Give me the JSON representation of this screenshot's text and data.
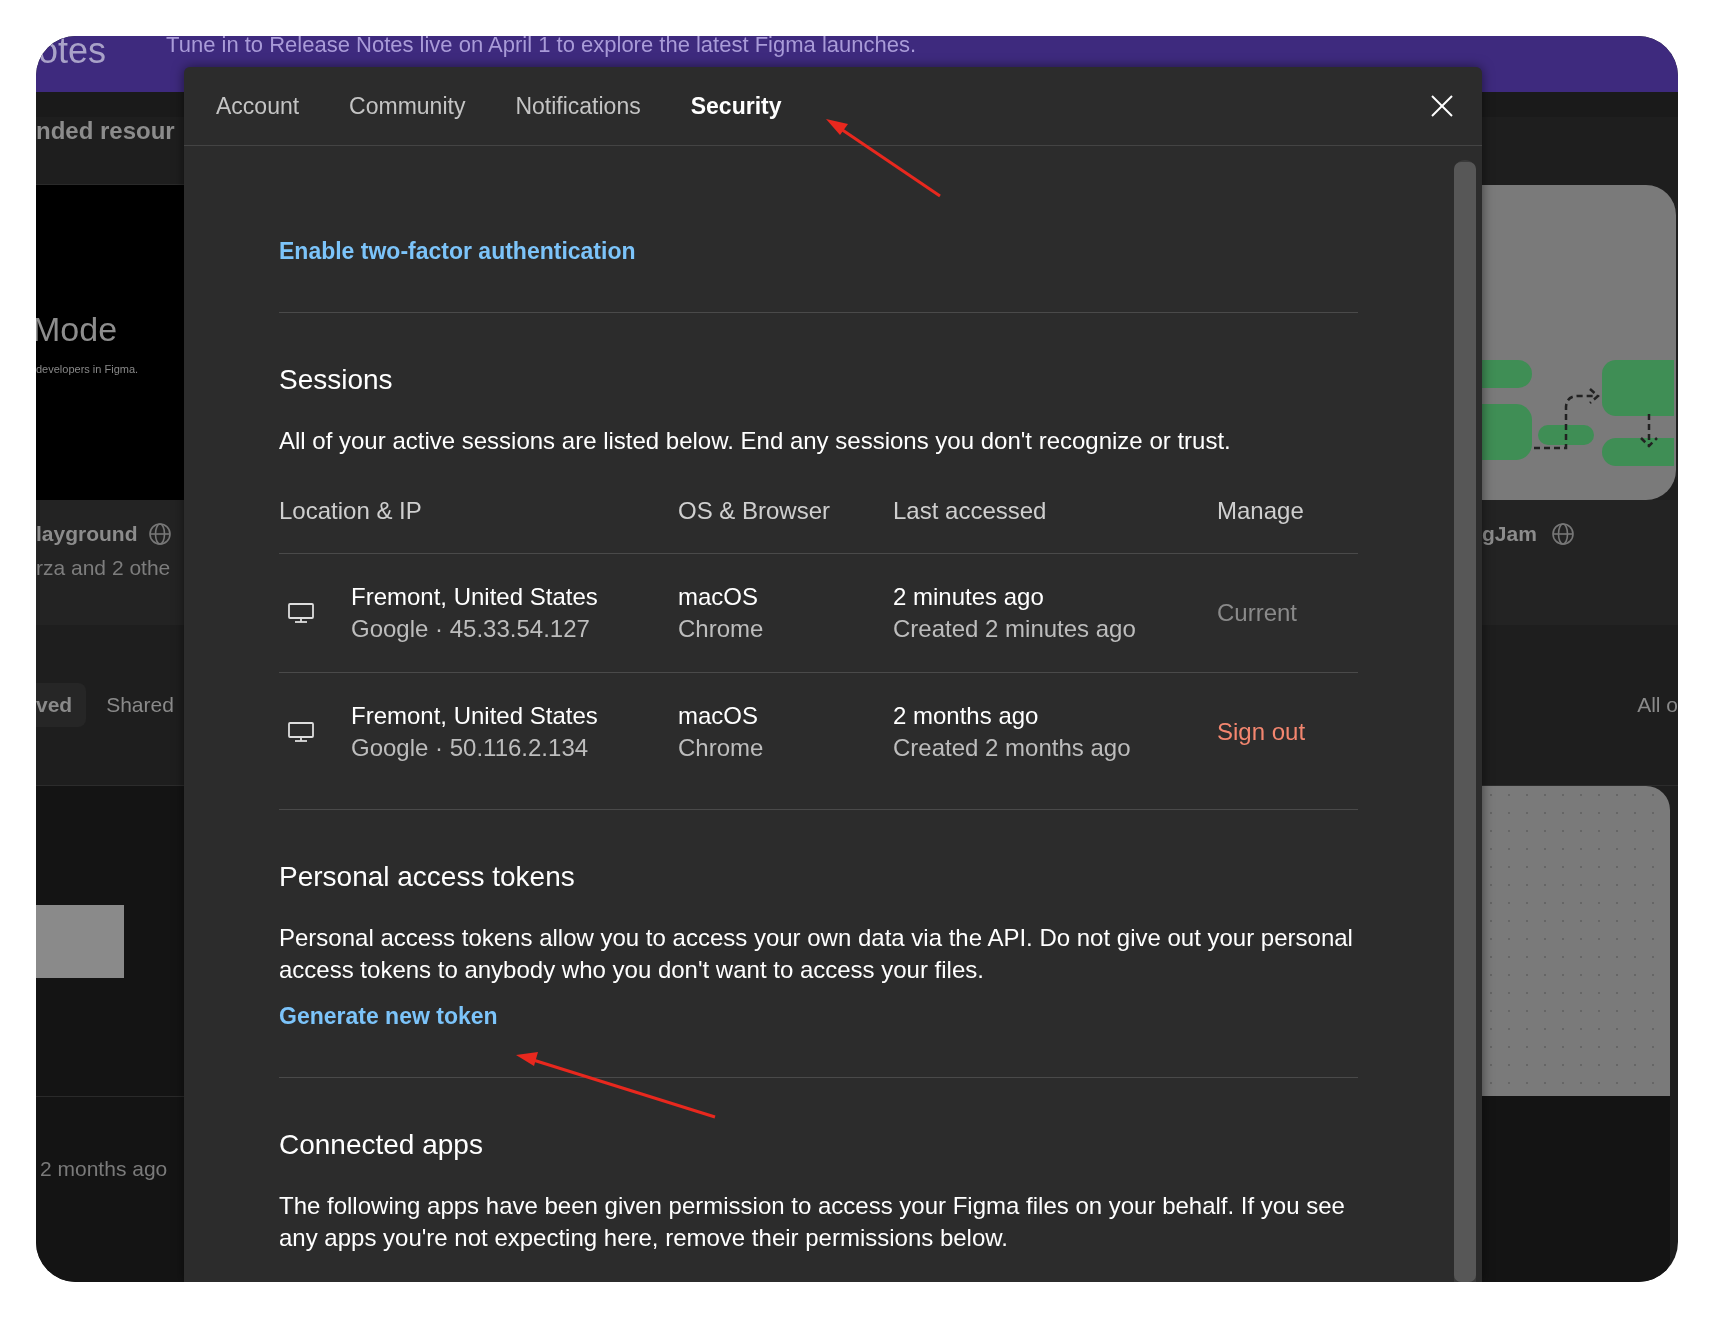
{
  "background": {
    "banner": {
      "heading": "otes",
      "text": "Tune in to Release Notes live on April 1 to explore the latest Figma launches."
    },
    "left": {
      "section_title": "nded resour",
      "card_title": "Mode",
      "card_subtitle": "developers in Figma.",
      "file_name": "layground",
      "file_people": "rza and 2 othe",
      "filter_tabs": [
        {
          "label": "ved",
          "selected": true
        },
        {
          "label": "Shared",
          "selected": false
        }
      ],
      "file_time": "2 months ago"
    },
    "right": {
      "file_name": "gJam",
      "filter_label": "All o"
    }
  },
  "modal": {
    "tabs": [
      {
        "label": "Account",
        "selected": false
      },
      {
        "label": "Community",
        "selected": false
      },
      {
        "label": "Notifications",
        "selected": false
      },
      {
        "label": "Security",
        "selected": true
      }
    ],
    "two_factor_link": "Enable two-factor authentication",
    "sessions": {
      "title": "Sessions",
      "description": "All of your active sessions are listed below. End any sessions you don't recognize or trust.",
      "columns": [
        "Location & IP",
        "OS & Browser",
        "Last accessed",
        "Manage"
      ],
      "rows": [
        {
          "location": "Fremont, United States",
          "ip": "Google · 45.33.54.127",
          "os": "macOS",
          "browser": "Chrome",
          "last_accessed": "2 minutes ago",
          "created": "Created 2 minutes ago",
          "manage": {
            "kind": "current",
            "label": "Current"
          }
        },
        {
          "location": "Fremont, United States",
          "ip": "Google · 50.116.2.134",
          "os": "macOS",
          "browser": "Chrome",
          "last_accessed": "2 months ago",
          "created": "Created 2 months ago",
          "manage": {
            "kind": "action",
            "label": "Sign out"
          }
        }
      ]
    },
    "tokens": {
      "title": "Personal access tokens",
      "description": "Personal access tokens allow you to access your own data via the API. Do not give out your personal access tokens to anybody who you don't want to access your files.",
      "link": "Generate new token"
    },
    "connected_apps": {
      "title": "Connected apps",
      "description": "The following apps have been given permission to access your Figma files on your behalf. If you see any apps you're not expecting here, remove their permissions below."
    }
  }
}
